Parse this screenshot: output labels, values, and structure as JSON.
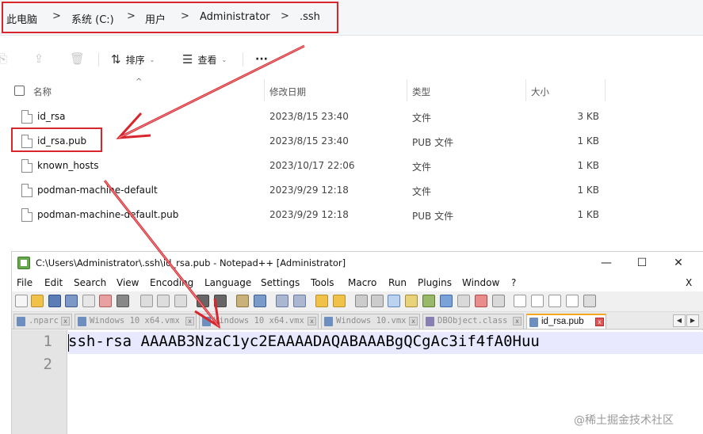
{
  "explorer": {
    "breadcrumb": [
      "此电脑",
      "系统 (C:)",
      "用户",
      "Administrator",
      ".ssh"
    ],
    "breadcrumb_separator": ">",
    "toolbar": {
      "sort_label": "排序",
      "view_label": "查看",
      "more_label": "···"
    },
    "columns": {
      "name": "名称",
      "date": "修改日期",
      "type": "类型",
      "size": "大小"
    },
    "files": [
      {
        "name": "id_rsa",
        "date": "2023/8/15 23:40",
        "type": "文件",
        "size": "3 KB"
      },
      {
        "name": "id_rsa.pub",
        "date": "2023/8/15 23:40",
        "type": "PUB 文件",
        "size": "1 KB"
      },
      {
        "name": "known_hosts",
        "date": "2023/10/17 22:06",
        "type": "文件",
        "size": "1 KB"
      },
      {
        "name": "podman-machine-default",
        "date": "2023/9/29 12:18",
        "type": "文件",
        "size": "1 KB"
      },
      {
        "name": "podman-machine-default.pub",
        "date": "2023/9/29 12:18",
        "type": "PUB 文件",
        "size": "1 KB"
      }
    ]
  },
  "notepad": {
    "title": "C:\\Users\\Administrator\\.ssh\\id_rsa.pub - Notepad++ [Administrator]",
    "window_controls": {
      "minimize": "—",
      "maximize": "☐",
      "close": "✕"
    },
    "menu": [
      "File",
      "Edit",
      "Search",
      "View",
      "Encoding",
      "Language",
      "Settings",
      "Tools",
      "Macro",
      "Run",
      "Plugins",
      "Window",
      "?"
    ],
    "menu_close": "X",
    "tabs": [
      {
        "label": ".nparc"
      },
      {
        "label": "Windows 10 x64.vmx"
      },
      {
        "label": "Windows 10 x64.vmx"
      },
      {
        "label": "Windows 10.vmx"
      },
      {
        "label": "DBObject.class"
      },
      {
        "label": "id_rsa.pub",
        "active": true
      }
    ],
    "tab_scroll": {
      "left": "◀",
      "right": "▶"
    },
    "line_numbers": [
      "1",
      "2"
    ],
    "code_lines": [
      "ssh-rsa AAAAB3NzaC1yc2EAAAADAQABAAABgQCgAc3if4fA0Huu",
      ""
    ]
  },
  "watermark": "@稀土掘金技术社区",
  "colors": {
    "highlight_red": "#d9252c",
    "active_tab_accent": "#f5a623",
    "current_line": "#e8e8ff"
  }
}
